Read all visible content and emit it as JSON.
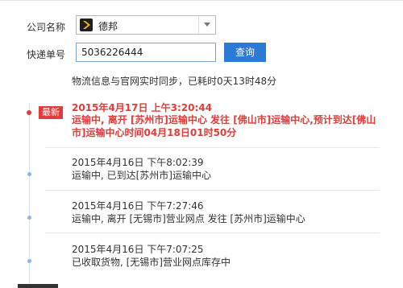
{
  "form": {
    "company_label": "公司名称",
    "company_value": "德邦",
    "tracking_label": "快递单号",
    "tracking_value": "5036226444",
    "query_button": "查询"
  },
  "sync_note": "物流信息与官网实时同步，已耗时0天13时48分",
  "latest_badge": "最新",
  "events": [
    {
      "time": "2015年4月17日 上午3:20:44",
      "text": "运输中, 离开 [苏州市]运输中心 发往 [佛山市]运输中心,预计到达[佛山市]运输中心时间04月18日01时50分",
      "latest": true
    },
    {
      "time": "2015年4月16日 下午8:02:39",
      "text": "运输中, 已到达[苏州市]运输中心",
      "latest": false
    },
    {
      "time": "2015年4月16日 下午7:27:46",
      "text": "运输中, 离开 [无锡市]营业网点 发往 [苏州市]运输中心",
      "latest": false
    },
    {
      "time": "2015年4月16日 下午7:07:25",
      "text": "已收取货物, [无锡市]营业网点库存中",
      "latest": false
    }
  ],
  "colors": {
    "accent": "#2a7ad6",
    "latest": "#e23b3b"
  }
}
